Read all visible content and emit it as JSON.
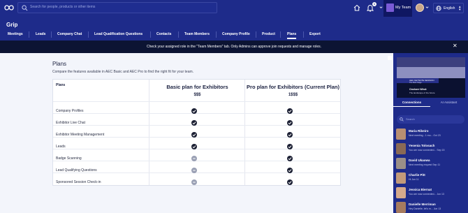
{
  "topbar": {
    "search_placeholder": "Search for people, products or other items",
    "notification_count": "1",
    "my_team_label": "My Team",
    "language": "English"
  },
  "header": {
    "org_name": "Grip",
    "tabs": [
      {
        "label": "Meetings"
      },
      {
        "label": "Leads"
      },
      {
        "label": "Company Chat"
      },
      {
        "label": "Lead Qualification Questions"
      },
      {
        "label": "Contacts"
      },
      {
        "label": "Team Members"
      },
      {
        "label": "Company Profile"
      },
      {
        "label": "Product"
      },
      {
        "label": "Plans",
        "active": true
      },
      {
        "label": "Export"
      }
    ]
  },
  "banner": {
    "message": "Check your assigned role in the \"Team Members\" tab. Only Admins can approve join requests and manage roles."
  },
  "plans": {
    "title": "Plans",
    "subtitle": "Compare the features available in AEC Basic and AEC Pro to find the right fit for your team.",
    "column_header": "Plans",
    "basic": {
      "name": "Basic plan for Exhibitors",
      "price": "$$$"
    },
    "pro": {
      "name": "Pro plan for Exhibitors (Current Plan)",
      "price": "1$$$"
    },
    "features": [
      {
        "name": "Company Profiles",
        "basic": true,
        "pro": true
      },
      {
        "name": "Exhibitor Live Chat",
        "basic": true,
        "pro": true
      },
      {
        "name": "Exhibitor Meeting Management",
        "basic": true,
        "pro": true
      },
      {
        "name": "Leads",
        "basic": true,
        "pro": true
      },
      {
        "name": "Badge Scanning",
        "basic": false,
        "pro": true
      },
      {
        "name": "Lead Qualifying Questions",
        "basic": false,
        "pro": true
      },
      {
        "name": "Sponsored Session Check-in",
        "basic": false,
        "pro": true
      }
    ]
  },
  "sidebar": {
    "promo": {
      "line1": "AEC KEYNOTE SESSION",
      "line2": "The Main Stage",
      "line3": "Onshore Wind:",
      "line4": "The landscape of the future"
    },
    "tabs": [
      {
        "label": "Connections",
        "active": true
      },
      {
        "label": "AI Assistant"
      }
    ],
    "search_placeholder": "Search",
    "connections": [
      {
        "name": "Maria Ribeiro",
        "message": "Next meeting - 1 mo...",
        "date": "Oct 23",
        "color": "#b88f72"
      },
      {
        "name": "Yesenia Tolosach",
        "message": "You are now connected...",
        "date": "Sep 15",
        "color": "#8a6a55"
      },
      {
        "name": "David Ukaowa",
        "message": "Next meeting request",
        "date": "Sep 11",
        "color": "#9a8f88"
      },
      {
        "name": "Charlie Pitt",
        "message": "Hi",
        "date": "Jun 11",
        "color": "#c29a7a"
      },
      {
        "name": "Jessica Biernat",
        "message": "You are now connected...",
        "date": "Jun 13",
        "color": "#d4a98c"
      },
      {
        "name": "Danielle Merriman",
        "message": "Hey Danielle, let's m...",
        "date": "Jun 13",
        "color": "#a67b5f"
      }
    ]
  },
  "colors": {
    "brand_navy": "#1e2b8a",
    "banner_dark": "#0c1433",
    "check_dark": "#1b1f33",
    "dash_gray": "#9aa0b4"
  }
}
